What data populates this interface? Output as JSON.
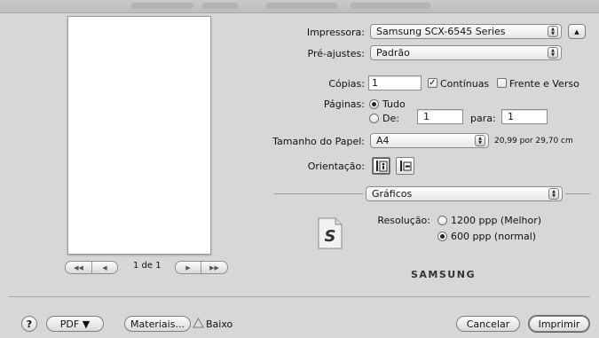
{
  "preview": {
    "page_indicator": "1 de 1",
    "nav_first": "◀◀",
    "nav_prev": "◀",
    "nav_next": "▶",
    "nav_last": "▶▶"
  },
  "printer": {
    "label": "Impressora:",
    "value": "Samsung SCX-6545 Series",
    "expand_symbol": "▲"
  },
  "presets": {
    "label": "Pré-ajustes:",
    "value": "Padrão"
  },
  "copies": {
    "label": "Cópias:",
    "value": "1",
    "collate_label": "Contínuas",
    "collate_checked": true,
    "duplex_label": "Frente e Verso",
    "duplex_checked": false
  },
  "pages": {
    "label": "Páginas:",
    "all_label": "Tudo",
    "from_label": "De:",
    "from_value": "1",
    "to_label": "para:",
    "to_value": "1",
    "selected": "all"
  },
  "paper_size": {
    "label": "Tamanho do Papel:",
    "value": "A4",
    "dimensions": "20,99 por 29,70 cm"
  },
  "orientation": {
    "label": "Orientação:",
    "selected": "portrait"
  },
  "panel": {
    "value": "Gráficos"
  },
  "resolution": {
    "label": "Resolução:",
    "option_high": "1200 ppp (Melhor)",
    "option_normal": "600 ppp (normal)",
    "selected": "normal"
  },
  "brand": {
    "logo_text": "SAMSUNG",
    "app_icon_letter": "S"
  },
  "bottom": {
    "help": "?",
    "pdf_label": "PDF ▼",
    "supplies_label": "Materiais...",
    "supply_status": "Baixo",
    "cancel_label": "Cancelar",
    "print_label": "Imprimir"
  },
  "colors": {
    "accent": "#2a5fc4",
    "background": "#d7d7d7",
    "warning_triangle": "#e0e0e0"
  }
}
